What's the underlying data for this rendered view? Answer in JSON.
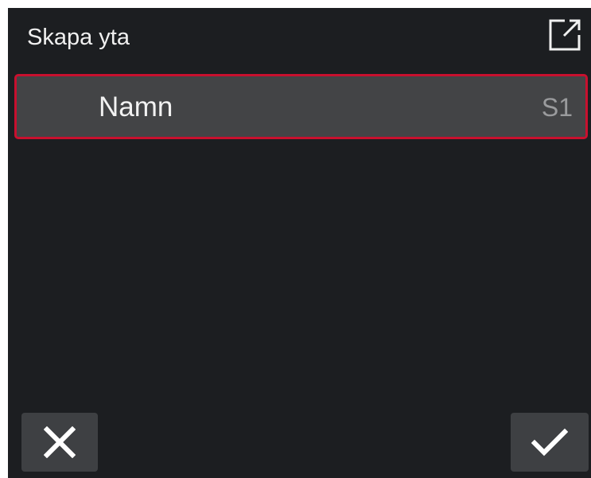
{
  "dialog": {
    "title": "Skapa yta",
    "expand_icon": "open-external-icon"
  },
  "fields": [
    {
      "label": "Namn",
      "value": "S1"
    }
  ],
  "footer": {
    "cancel_icon": "close-icon",
    "confirm_icon": "checkmark-icon"
  },
  "colors": {
    "background": "#1c1e21",
    "row_background": "#434446",
    "selection_border": "#c8102e",
    "button_background": "#3e4043",
    "text_primary": "#f2f2f2",
    "text_secondary": "#9a9b9d"
  }
}
